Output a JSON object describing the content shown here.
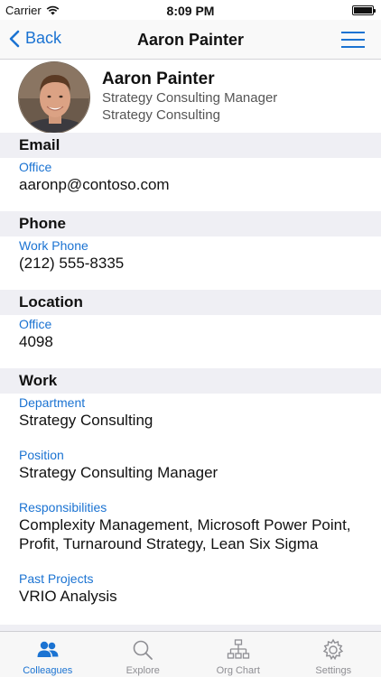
{
  "status": {
    "carrier": "Carrier",
    "time": "8:09 PM"
  },
  "nav": {
    "back_label": "Back",
    "title": "Aaron Painter"
  },
  "profile": {
    "name": "Aaron Painter",
    "title": "Strategy Consulting Manager",
    "department": "Strategy Consulting"
  },
  "sections": {
    "email": {
      "header": "Email",
      "label": "Office",
      "value": "aaronp@contoso.com"
    },
    "phone": {
      "header": "Phone",
      "label": "Work Phone",
      "value": "(212) 555-8335"
    },
    "location": {
      "header": "Location",
      "label": "Office",
      "value": "4098"
    },
    "work": {
      "header": "Work",
      "department_label": "Department",
      "department_value": "Strategy Consulting",
      "position_label": "Position",
      "position_value": "Strategy Consulting Manager",
      "responsibilities_label": "Responsibilities",
      "responsibilities_line1": "Complexity Management, Microsoft Power Point,",
      "responsibilities_line2": "Profit, Turnaround Strategy, Lean Six Sigma",
      "past_projects_label": "Past Projects",
      "past_projects_value": "VRIO Analysis"
    }
  },
  "tabs": [
    {
      "label": "Colleagues",
      "icon": "people-icon",
      "active": true
    },
    {
      "label": "Explore",
      "icon": "search-icon",
      "active": false
    },
    {
      "label": "Org Chart",
      "icon": "org-chart-icon",
      "active": false
    },
    {
      "label": "Settings",
      "icon": "gear-icon",
      "active": false
    }
  ],
  "colors": {
    "accent": "#1b73d2",
    "section_bg": "#efeff4",
    "inactive": "#8e8e93"
  }
}
